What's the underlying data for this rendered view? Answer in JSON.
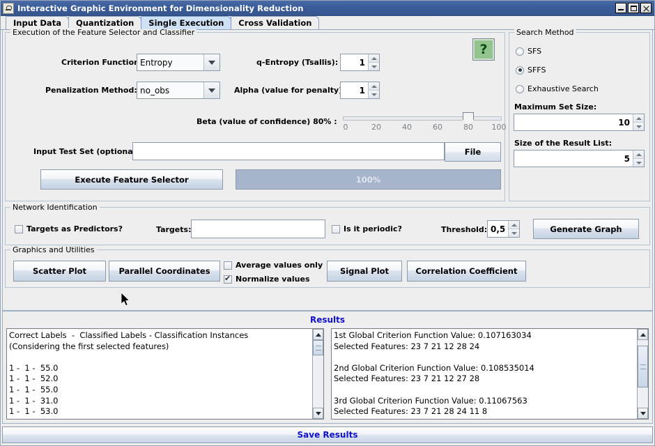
{
  "window": {
    "title": "Interactive Graphic Environment for Dimensionality Reduction",
    "icon": "app-icon",
    "minimize_label": "_",
    "maximize_label": "□",
    "close_label": "✕"
  },
  "tabs": [
    {
      "label": "Input Data",
      "active": false
    },
    {
      "label": "Quantization",
      "active": false
    },
    {
      "label": "Single Execution",
      "active": true
    },
    {
      "label": "Cross Validation",
      "active": false
    }
  ],
  "execution_group": {
    "legend": "Execution of the Feature Selector and Classifier",
    "criterion_function": {
      "label": "Criterion Function:",
      "value": "Entropy",
      "icon": "chevron-down-icon"
    },
    "penalization_method": {
      "label": "Penalization Method:",
      "value": "no_obs",
      "icon": "chevron-down-icon"
    },
    "q_entropy": {
      "label": "q-Entropy (Tsallis):",
      "value": "1"
    },
    "alpha": {
      "label": "Alpha (value for penalty):",
      "value": "1"
    },
    "beta": {
      "label": "Beta (value of confidence) 80% :",
      "value": 80,
      "ticks": [
        "0",
        "20",
        "40",
        "60",
        "80",
        "100"
      ],
      "min": 0,
      "max": 100
    },
    "input_test_set": {
      "label": "Input Test Set (optional):",
      "value": "",
      "placeholder": ""
    },
    "file_button": "File",
    "execute_button": "Execute Feature Selector",
    "progress": {
      "label": "100%",
      "percent": 100,
      "color": "#a7b5cc"
    },
    "help_button": "?"
  },
  "search_method_group": {
    "legend": "Search Method",
    "options": [
      {
        "label": "SFS",
        "selected": false
      },
      {
        "label": "SFFS",
        "selected": true
      },
      {
        "label": "Exhaustive Search",
        "selected": false
      }
    ],
    "max_set_size": {
      "label": "Maximum Set Size:",
      "value": "10"
    },
    "result_list_size": {
      "label": "Size of the Result List:",
      "value": "5"
    }
  },
  "network_group": {
    "legend": "Network Identification",
    "targets_as_predictors": {
      "label": "Targets as Predictors?",
      "checked": false
    },
    "targets": {
      "label": "Targets:",
      "value": ""
    },
    "is_periodic": {
      "label": "Is it periodic?",
      "checked": false
    },
    "threshold": {
      "label": "Threshold:",
      "value": "0,5"
    },
    "generate_graph_button": "Generate Graph"
  },
  "graphics_group": {
    "legend": "Graphics and Utilities",
    "scatter_plot_button": "Scatter Plot",
    "parallel_coordinates_button": "Parallel Coordinates",
    "average_values_only": {
      "label": "Average values only",
      "checked": false
    },
    "normalize_values": {
      "label": "Normalize values",
      "checked": true
    },
    "signal_plot_button": "Signal Plot",
    "correlation_coefficient_button": "Correlation Coefficient"
  },
  "results": {
    "title": "Results",
    "left_text": "Correct Labels  -  Classified Labels - Classification Instances\n(Considering the first selected features)\n\n1 -  1 -  55.0\n1 -  1 -  52.0\n1 -  1 -  55.0\n1 -  1 -  31.0\n1 -  1 -  53.0",
    "right_text": "1st Global Criterion Function Value: 0.107163034\nSelected Features: 23 7 21 12 28 24\n\n2nd Global Criterion Function Value: 0.108535014\nSelected Features: 23 7 21 12 27 28\n\n3rd Global Criterion Function Value: 0.11067563\nSelected Features: 23 7 21 28 24 11 8",
    "save_button": "Save Results"
  }
}
